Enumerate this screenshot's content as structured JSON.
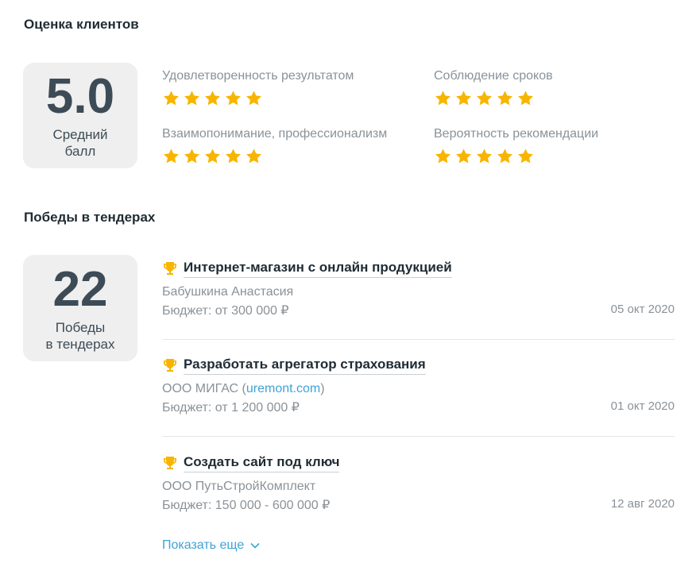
{
  "ratings": {
    "section_title": "Оценка клиентов",
    "score": "5.0",
    "score_label_line1": "Средний",
    "score_label_line2": "балл",
    "star_color": "#f7b500",
    "criteria": [
      {
        "label": "Удовлетворенность результатом",
        "stars": 5
      },
      {
        "label": "Соблюдение сроков",
        "stars": 5
      },
      {
        "label": "Взаимопонимание, профессионализм",
        "stars": 5
      },
      {
        "label": "Вероятность рекомендации",
        "stars": 5
      }
    ]
  },
  "tenders": {
    "section_title": "Победы в тендерах",
    "count": "22",
    "count_label_line1": "Победы",
    "count_label_line2": "в тендерах",
    "items": [
      {
        "title": "Интернет-магазин с онлайн продукцией",
        "client": "Бабушкина Анастасия",
        "budget": "Бюджет: от 300 000 ₽",
        "date": "05 окт 2020"
      },
      {
        "title": "Разработать агрегатор страхования",
        "client": "ООО МИГАС (",
        "client_link": "uremont.com",
        "client_suffix": ")",
        "budget": "Бюджет: от 1 200 000 ₽",
        "date": "01 окт 2020"
      },
      {
        "title": "Создать сайт под ключ",
        "client": "ООО ПутьСтройКомплект",
        "budget": "Бюджет: 150 000 - 600 000 ₽",
        "date": "12 авг 2020"
      }
    ],
    "show_more_label": "Показать еще"
  }
}
